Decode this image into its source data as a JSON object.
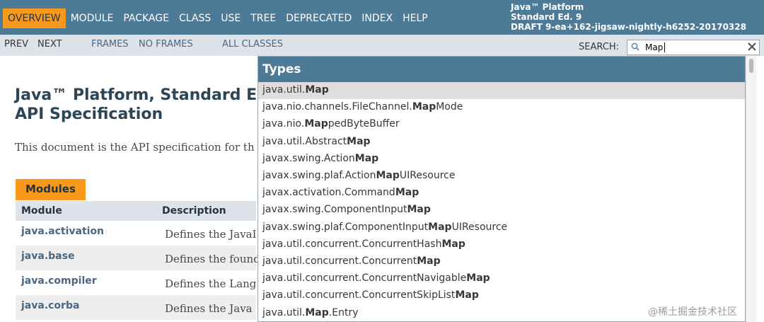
{
  "topnav": {
    "items": [
      "OVERVIEW",
      "MODULE",
      "PACKAGE",
      "CLASS",
      "USE",
      "TREE",
      "DEPRECATED",
      "INDEX",
      "HELP"
    ],
    "about": [
      "Java™ Platform",
      "Standard Ed. 9",
      "DRAFT 9-ea+162-jigsaw-nightly-h6252-20170328"
    ]
  },
  "subnav": {
    "prev": "PREV",
    "next": "NEXT",
    "frames": "FRAMES",
    "no_frames": "NO FRAMES",
    "all_classes": "ALL CLASSES",
    "search_label": "SEARCH:",
    "search_value": "Map"
  },
  "main": {
    "title_line1": "Java™ Platform, Standard E",
    "title_line2": "API Specification",
    "intro": "This document is the API specification for th",
    "modules_tab": "Modules",
    "col_module": "Module",
    "col_description": "Description",
    "rows": [
      {
        "module": "java.activation",
        "desc": "Defines the JavaI"
      },
      {
        "module": "java.base",
        "desc": "Defines the found"
      },
      {
        "module": "java.compiler",
        "desc": "Defines the Lang"
      },
      {
        "module": "java.corba",
        "desc": "Defines the Java"
      }
    ]
  },
  "dropdown": {
    "header": "Types",
    "items": [
      {
        "pre": "java.util.",
        "match": "Map",
        "post": ""
      },
      {
        "pre": "java.nio.channels.FileChannel.",
        "match": "Map",
        "post": "Mode"
      },
      {
        "pre": "java.nio.",
        "match": "Map",
        "post": "pedByteBuffer"
      },
      {
        "pre": "java.util.Abstract",
        "match": "Map",
        "post": ""
      },
      {
        "pre": "javax.swing.Action",
        "match": "Map",
        "post": ""
      },
      {
        "pre": "javax.swing.plaf.Action",
        "match": "Map",
        "post": "UIResource"
      },
      {
        "pre": "javax.activation.Command",
        "match": "Map",
        "post": ""
      },
      {
        "pre": "javax.swing.ComponentInput",
        "match": "Map",
        "post": ""
      },
      {
        "pre": "javax.swing.plaf.ComponentInput",
        "match": "Map",
        "post": "UIResource"
      },
      {
        "pre": "java.util.concurrent.ConcurrentHash",
        "match": "Map",
        "post": ""
      },
      {
        "pre": "java.util.concurrent.Concurrent",
        "match": "Map",
        "post": ""
      },
      {
        "pre": "java.util.concurrent.ConcurrentNavigable",
        "match": "Map",
        "post": ""
      },
      {
        "pre": "java.util.concurrent.ConcurrentSkipList",
        "match": "Map",
        "post": ""
      },
      {
        "pre": "java.util.",
        "match": "Map",
        "post": ".Entry"
      }
    ]
  },
  "watermark": "@稀土掘金技术社区"
}
